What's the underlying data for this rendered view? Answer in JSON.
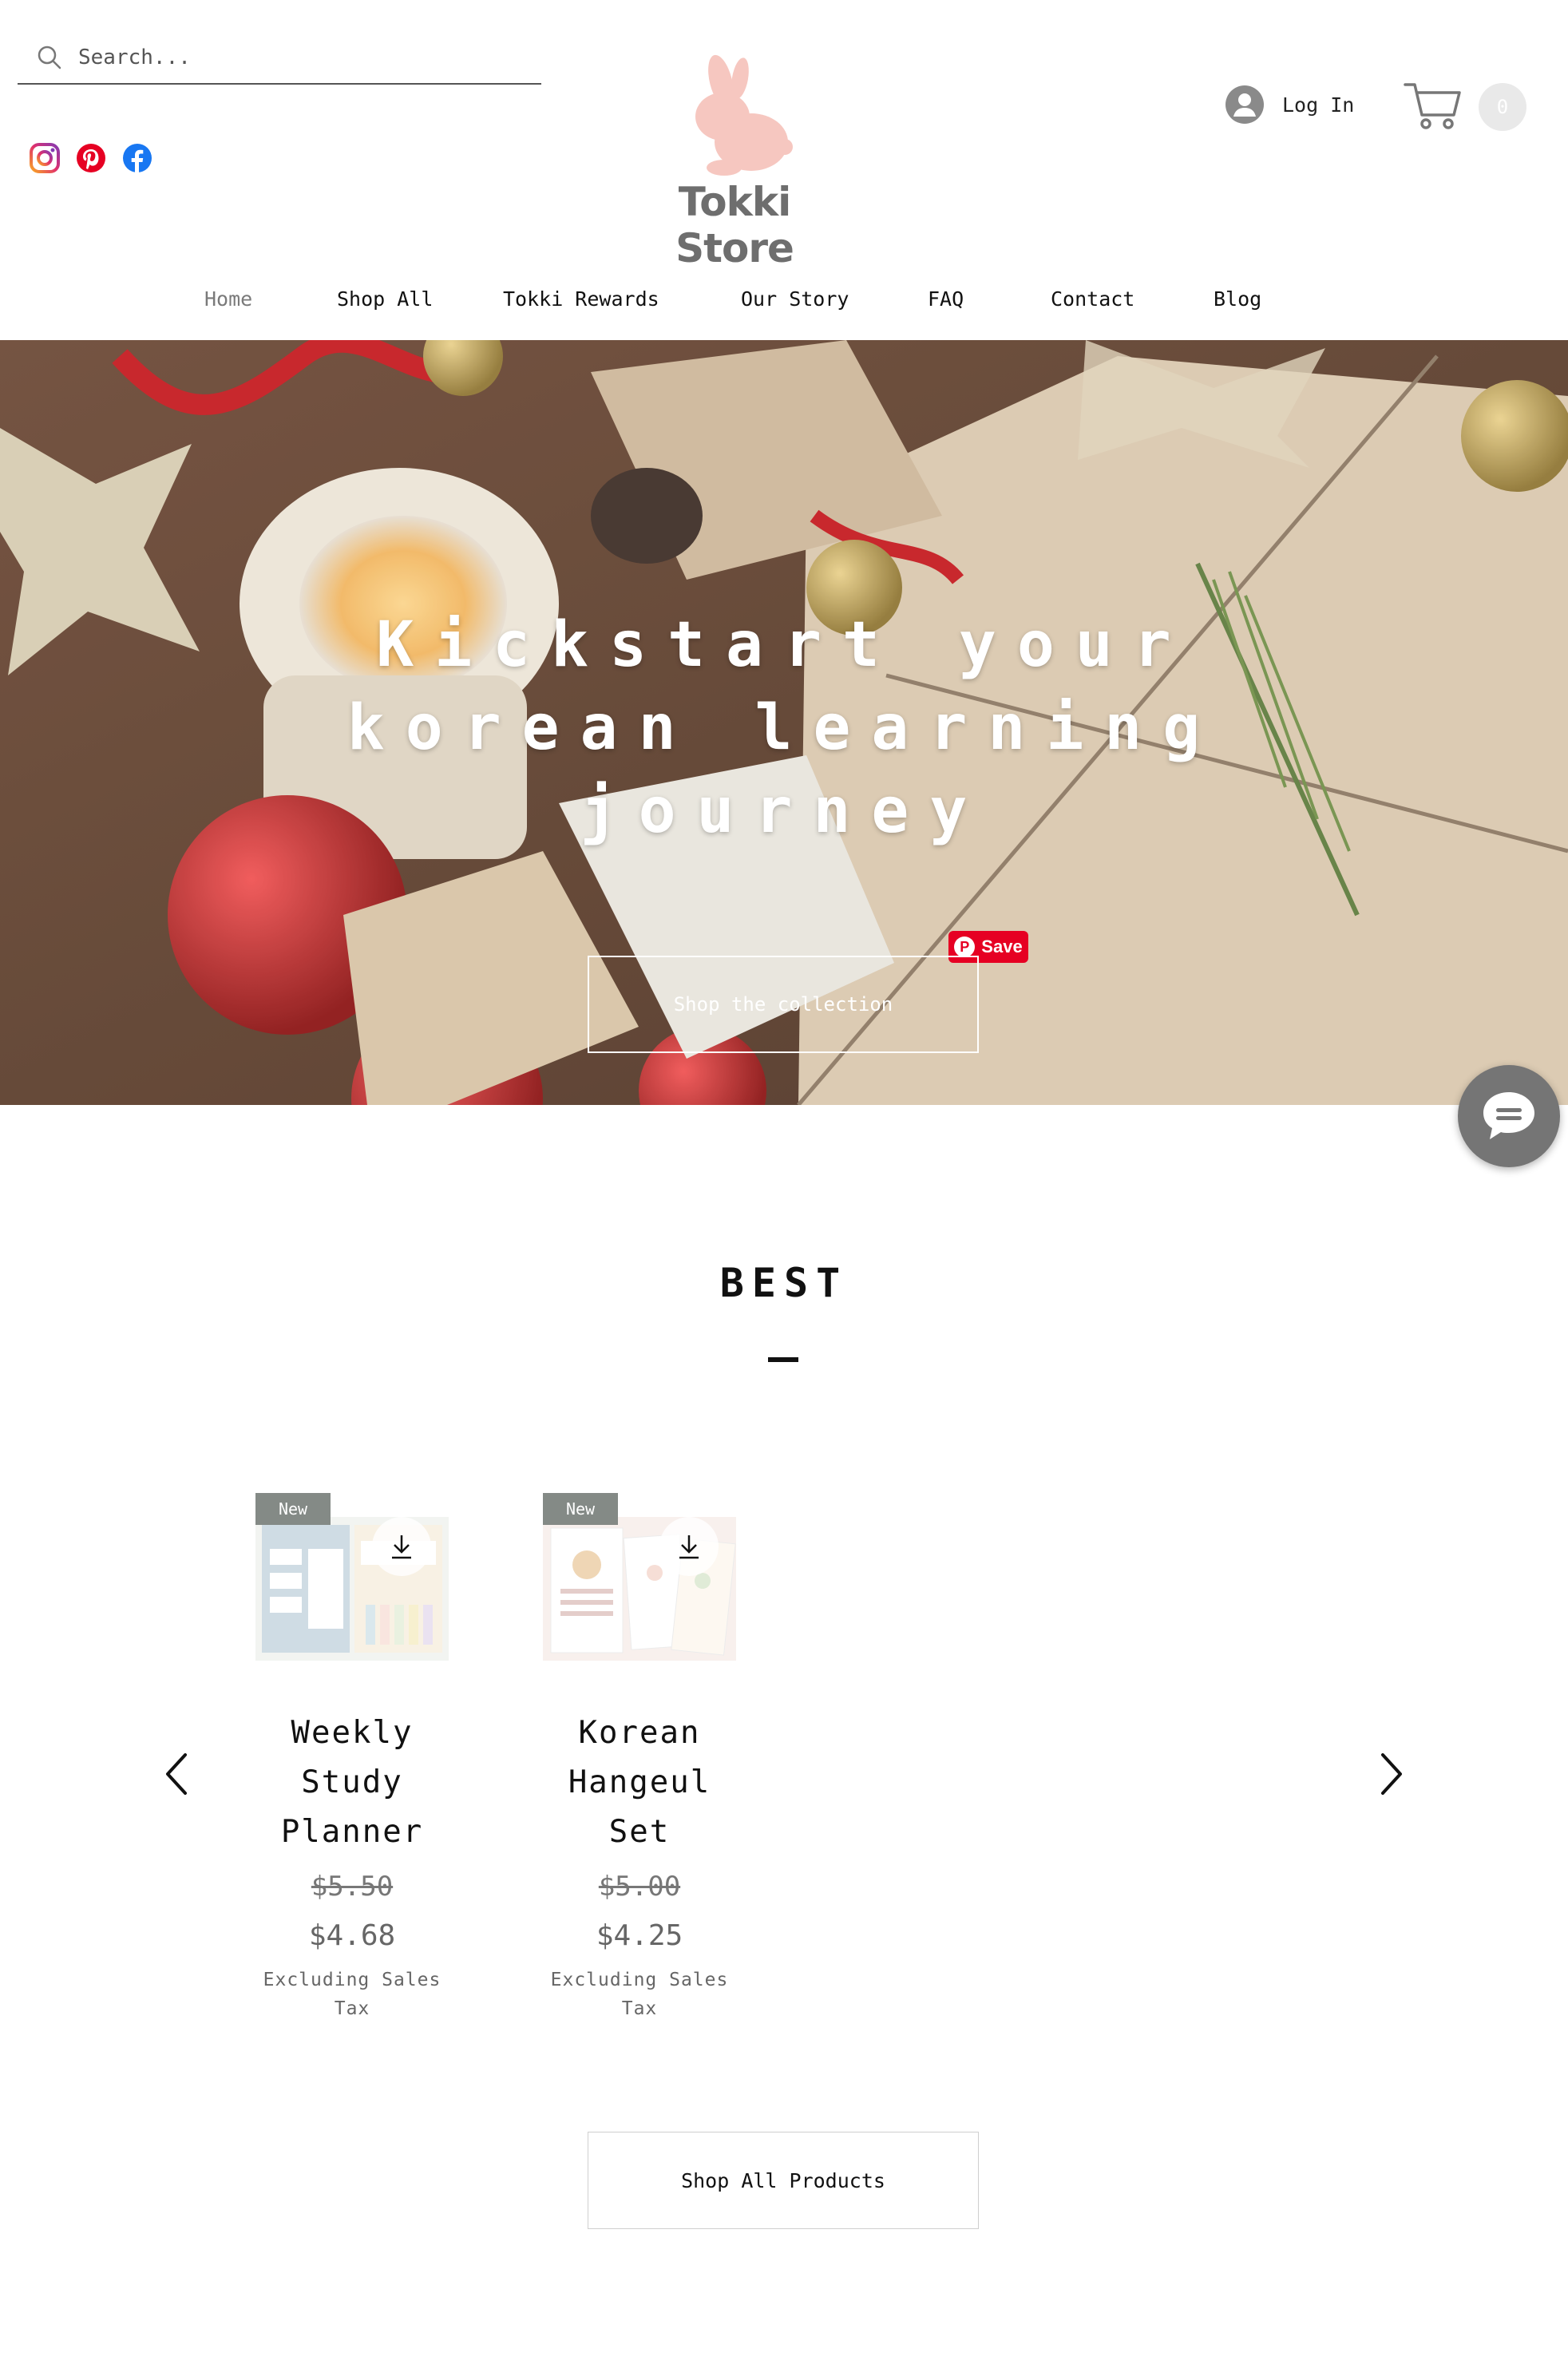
{
  "header": {
    "search": {
      "placeholder": "Search..."
    },
    "socials": [
      {
        "icon": "instagram-icon",
        "color": "#e1306c"
      },
      {
        "icon": "pinterest-icon",
        "color": "#e60023"
      },
      {
        "icon": "facebook-icon",
        "color": "#1877f2"
      }
    ],
    "logo": {
      "text": "Tokki Store",
      "rabbit_color": "#f6c7c0",
      "text_color": "#6e6e6e"
    },
    "login": {
      "label": "Log In"
    },
    "cart": {
      "count": "0"
    }
  },
  "nav": {
    "items": [
      {
        "label": "Home",
        "active": true
      },
      {
        "label": "Shop All"
      },
      {
        "label": "Tokki Rewards"
      },
      {
        "label": "Our Story"
      },
      {
        "label": "FAQ"
      },
      {
        "label": "Contact"
      },
      {
        "label": "Blog"
      }
    ]
  },
  "hero": {
    "title": "Kickstart your korean learning journey",
    "button": "Shop the collection",
    "pin_save": "Save"
  },
  "best": {
    "title": "BEST",
    "products": [
      {
        "badge": "New",
        "name": "Weekly Study Planner",
        "price_old": "$5.50",
        "price_new": "$4.68",
        "tax_note": "Excluding Sales Tax"
      },
      {
        "badge": "New",
        "name": "Korean Hangeul Set",
        "price_old": "$5.00",
        "price_new": "$4.25",
        "tax_note": "Excluding Sales Tax"
      }
    ],
    "shop_all_button": "Shop All Products"
  },
  "colors": {
    "accent": "#111111",
    "badge": "#848a86",
    "pinterest": "#e60023",
    "chat": "#757575"
  }
}
